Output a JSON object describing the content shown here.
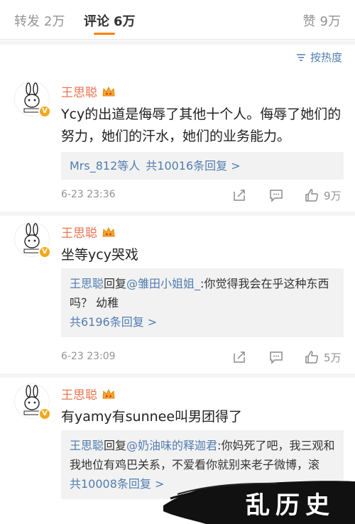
{
  "tabs": [
    {
      "label": "转发",
      "count": "2万"
    },
    {
      "label": "评论",
      "count": "6万"
    },
    {
      "label": "赞",
      "count": "9万"
    }
  ],
  "sort": {
    "label": "按热度",
    "icon": "sort-icon"
  },
  "accent": "#ff8200",
  "link_color": "#507daf",
  "name_color": "#eb7350",
  "comments": [
    {
      "user": "王思聪",
      "text": "Ycy的出道是侮辱了其他十个人。侮辱了她们的努力，她们的汗水，她们的业务能力。",
      "reply_summary": {
        "users": "Mrs_812等人",
        "more": "共10016条回复 >"
      },
      "time": "6-23 23:36",
      "likes": "9万"
    },
    {
      "user": "王思聪",
      "text": "坐等ycy哭戏",
      "reply": {
        "author": "王思聪",
        "verb": "回复",
        "target": "@雏田小姐姐_",
        "text": ":你觉得我会在乎这种东西吗？ 幼稚"
      },
      "more": "共6196条回复 >",
      "time": "6-23 23:09",
      "likes": "5万"
    },
    {
      "user": "王思聪",
      "text": "有yamy有sunnee叫男团得了",
      "reply": {
        "author": "王思聪",
        "verb": "回复",
        "target": "@奶油味的释迦君",
        "text": ":你妈死了吧，我三观和我地位有鸡巴关系，不爱看你就别来老子微博，滚"
      },
      "more": "共10008条回复 >"
    }
  ],
  "watermark": "乱历史"
}
